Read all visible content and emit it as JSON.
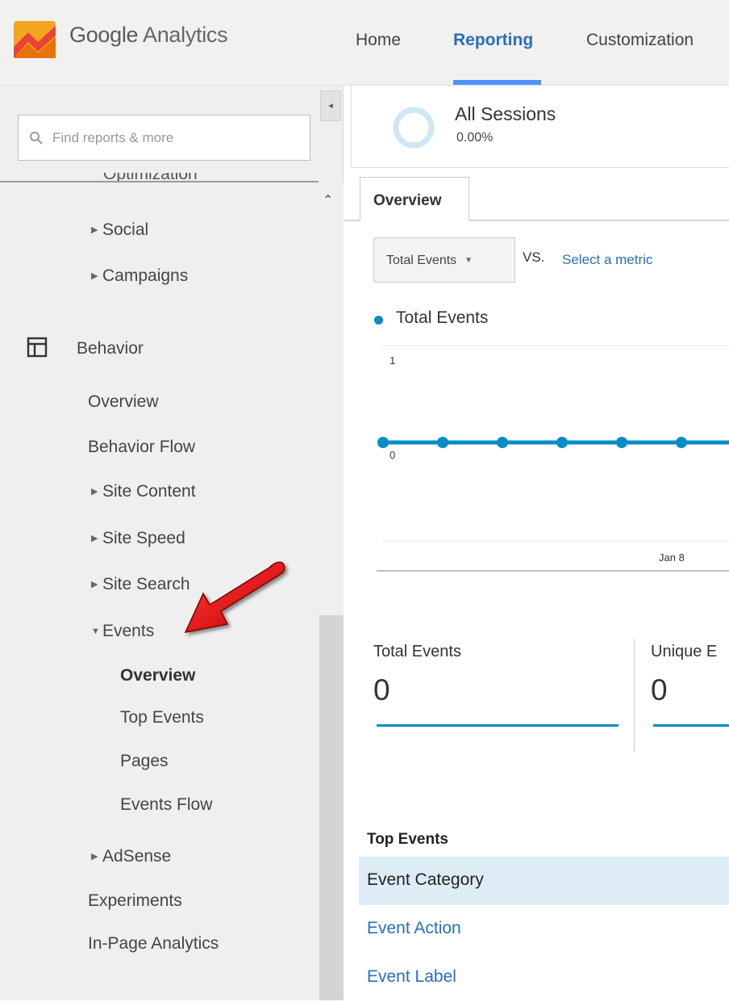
{
  "header": {
    "logo_google": "Google",
    "logo_product": "Analytics",
    "nav": [
      {
        "label": "Home",
        "active": false
      },
      {
        "label": "Reporting",
        "active": true
      },
      {
        "label": "Customization",
        "active": false
      }
    ],
    "accent": "#4d90fe"
  },
  "sidebar": {
    "search_placeholder": "Find reports & more",
    "cut_item": "Optimization",
    "items": {
      "social": "Social",
      "campaigns": "Campaigns",
      "behavior": "Behavior",
      "overview": "Overview",
      "behavior_flow": "Behavior Flow",
      "site_content": "Site Content",
      "site_speed": "Site Speed",
      "site_search": "Site Search",
      "events": "Events",
      "events_overview": "Overview",
      "top_events": "Top Events",
      "pages": "Pages",
      "events_flow": "Events Flow",
      "adsense": "AdSense",
      "experiments": "Experiments",
      "in_page_analytics": "In-Page Analytics"
    }
  },
  "main": {
    "segment": {
      "name": "All Sessions",
      "percent": "0.00%"
    },
    "tab": "Overview",
    "metric_select": "Total Events",
    "vs": "VS.",
    "select_metric_link": "Select a metric",
    "scorecards": [
      {
        "title": "Total Events",
        "value": "0"
      },
      {
        "title": "Unique E",
        "value": "0"
      }
    ],
    "top_events": {
      "title": "Top Events",
      "rows": [
        "Event Category",
        "Event Action",
        "Event Label"
      ]
    }
  },
  "chart_data": {
    "type": "line",
    "series": [
      {
        "name": "Total Events",
        "values": [
          0,
          0,
          0,
          0,
          0,
          0,
          0
        ]
      }
    ],
    "color": "#058dc7",
    "yticks": [
      "1",
      "0"
    ],
    "ylim": [
      0,
      1
    ],
    "xtick_label": "Jan 8",
    "grid": true
  }
}
